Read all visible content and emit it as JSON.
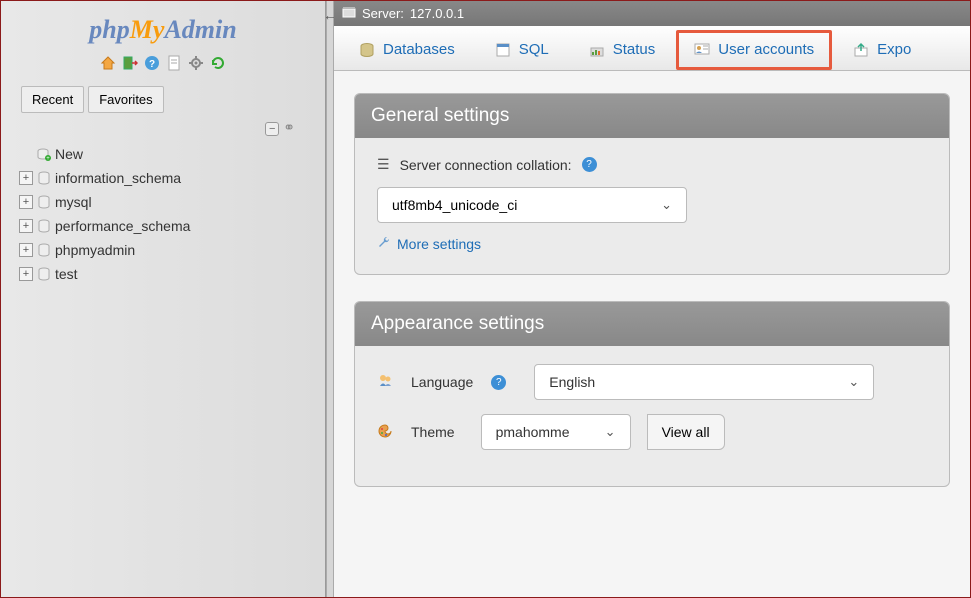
{
  "logo": {
    "php": "php",
    "my": "My",
    "admin": "Admin"
  },
  "sidebar": {
    "tabs": {
      "recent": "Recent",
      "favorites": "Favorites"
    },
    "tree": {
      "new": "New",
      "items": [
        "information_schema",
        "mysql",
        "performance_schema",
        "phpmyadmin",
        "test"
      ]
    }
  },
  "server_bar": {
    "label": "Server:",
    "host": "127.0.0.1"
  },
  "topnav": {
    "databases": "Databases",
    "sql": "SQL",
    "status": "Status",
    "user_accounts": "User accounts",
    "export": "Expo"
  },
  "general": {
    "title": "General settings",
    "collation_label": "Server connection collation:",
    "collation_value": "utf8mb4_unicode_ci",
    "more": "More settings"
  },
  "appearance": {
    "title": "Appearance settings",
    "language_label": "Language",
    "language_value": "English",
    "theme_label": "Theme",
    "theme_value": "pmahomme",
    "view_all": "View all"
  }
}
